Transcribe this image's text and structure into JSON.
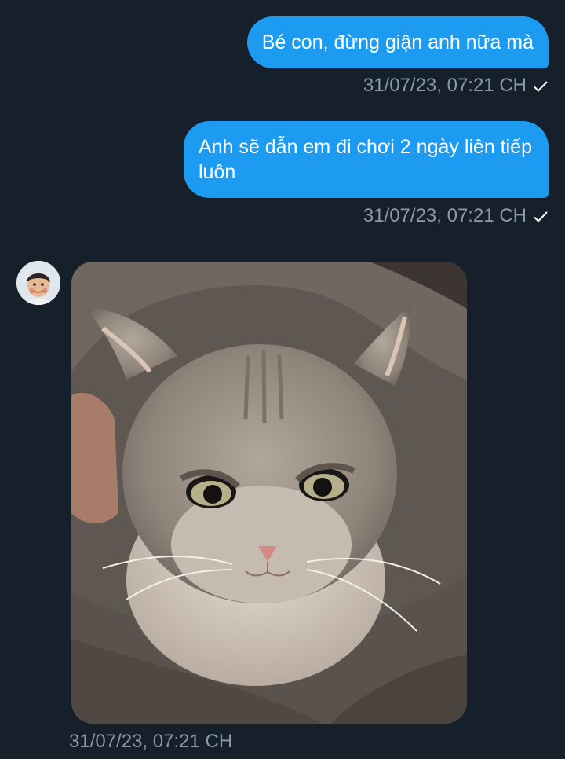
{
  "messages": [
    {
      "direction": "outgoing",
      "text": "Bé con, đừng giận anh nữa mà",
      "timestamp": "31/07/23, 07:21 CH",
      "status_icon": "check-icon"
    },
    {
      "direction": "outgoing",
      "text": "Anh sẽ dẫn em đi chơi 2 ngày liên tiếp luôn",
      "timestamp": "31/07/23, 07:21 CH",
      "status_icon": "check-icon"
    },
    {
      "direction": "incoming",
      "type": "image",
      "image_subject": "grumpy grey cat",
      "avatar_icon": "user-avatar",
      "timestamp": "31/07/23, 07:21 CH"
    }
  ],
  "colors": {
    "background": "#15202b",
    "outgoing_bubble": "#1d9bf0",
    "timestamp": "#8b98a5"
  }
}
